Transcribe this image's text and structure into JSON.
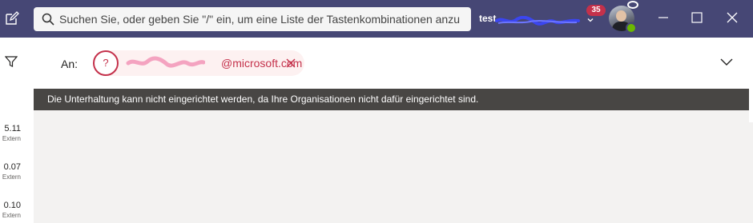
{
  "search": {
    "placeholder": "Suchen Sie, oder geben Sie \"/\" ein, um eine Liste der Tastenkombinationen anzu"
  },
  "account": {
    "tenant_name": "test",
    "notification_count": "35"
  },
  "chat_list": [
    {
      "time": "5.11",
      "tag": "Extern"
    },
    {
      "time": "0.07",
      "tag": "Extern"
    },
    {
      "time": "0.10",
      "tag": "Extern"
    }
  ],
  "compose": {
    "to_label": "An:",
    "recipient_email": "@microsoft.com",
    "recipient_status_glyph": "?"
  },
  "banner": {
    "message": "Die Unterhaltung kann nicht eingerichtet werden, da Ihre Organisationen nicht dafür eingerichtet sind."
  },
  "colors": {
    "titlebar": "#464775",
    "error_red": "#c4314b",
    "banner_bg": "#484644",
    "chat_bg": "#f3f2f1",
    "presence_available": "#6bb700"
  },
  "icons": [
    "compose-icon",
    "search-icon",
    "chevron-down-icon",
    "presence-available-icon",
    "minimize-icon",
    "maximize-icon",
    "close-icon",
    "filter-icon",
    "remove-icon",
    "expand-chevron-icon"
  ]
}
